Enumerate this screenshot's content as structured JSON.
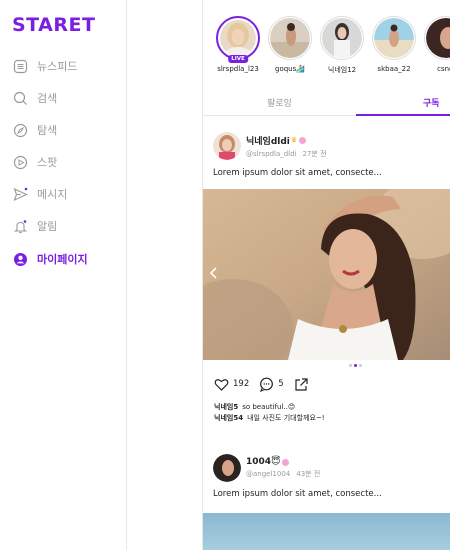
{
  "app": {
    "logo": "STARET"
  },
  "sidebar": {
    "items": [
      {
        "label": "뉴스피드",
        "icon": "newsfeed-icon",
        "active": false
      },
      {
        "label": "검색",
        "icon": "search-icon",
        "active": false
      },
      {
        "label": "탐색",
        "icon": "compass-icon",
        "active": false
      },
      {
        "label": "스팟",
        "icon": "play-icon",
        "active": false
      },
      {
        "label": "메시지",
        "icon": "send-icon",
        "active": false
      },
      {
        "label": "알림",
        "icon": "bell-icon",
        "active": false
      },
      {
        "label": "마이페이지",
        "icon": "profile-icon",
        "active": true
      }
    ]
  },
  "stories": [
    {
      "name": "slrspdla_l23",
      "live": true,
      "live_label": "LIVE"
    },
    {
      "name": "goqus🏄",
      "live": false
    },
    {
      "name": "닉네임12",
      "live": false
    },
    {
      "name": "skbaa_22",
      "live": false
    },
    {
      "name": "csncl",
      "live": false
    }
  ],
  "tabs": {
    "following": "팔로잉",
    "subscribe": "구독",
    "active": "subscribe"
  },
  "posts": [
    {
      "nickname": "닉네임dldi",
      "username": "@slrspdla_dldi",
      "time": "27분 전",
      "text": "Lorem ipsum dolor sit amet, consecte...",
      "likes": "192",
      "comments_count": "5",
      "comments": [
        {
          "user": "닉네임5",
          "text": "so beautiful..😊"
        },
        {
          "user": "닉네임54",
          "text": "내일 사진도 기대할께요~!"
        }
      ]
    },
    {
      "nickname": "1004😇",
      "username": "@angel1004",
      "time": "43분 전",
      "text": "Lorem ipsum dolor sit amet, consecte..."
    }
  ],
  "colors": {
    "accent": "#7a1fe0",
    "muted": "#9a9a9a",
    "divider": "#e6e6e6"
  }
}
